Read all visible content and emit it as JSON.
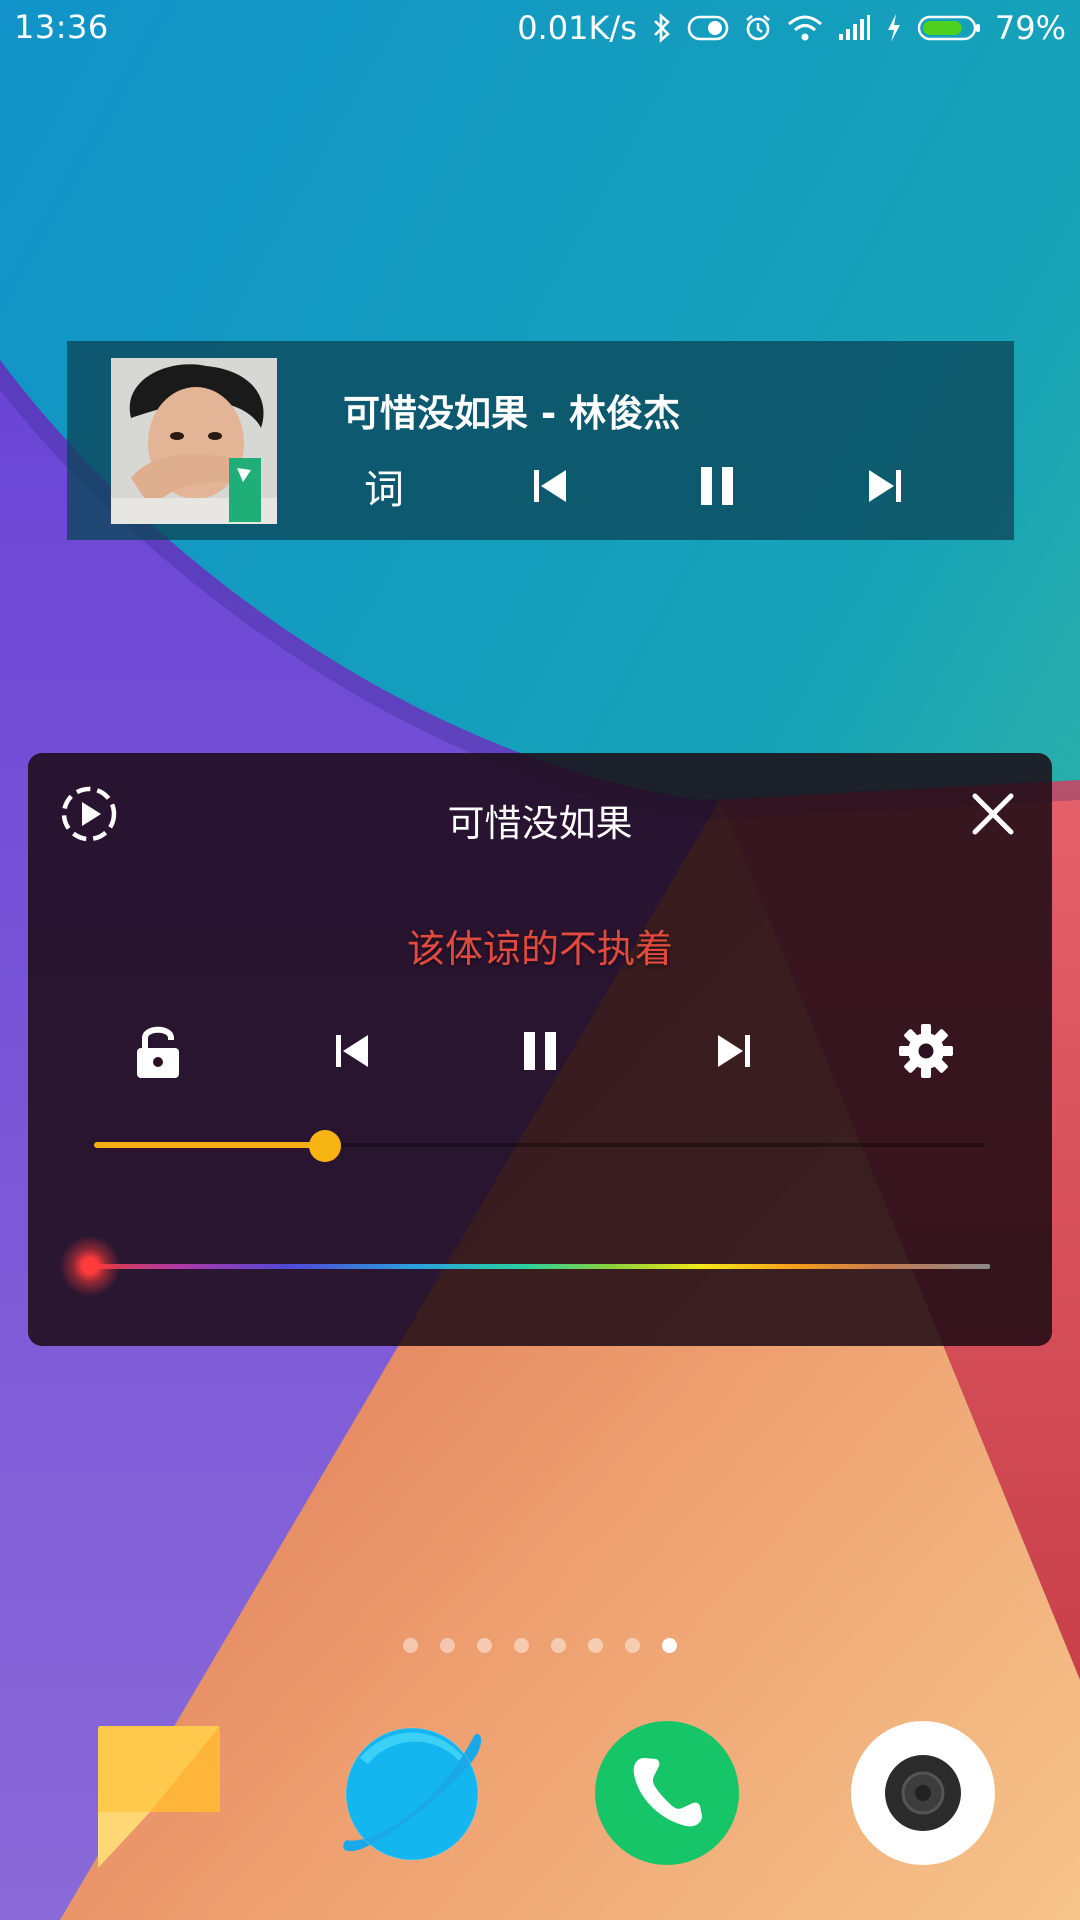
{
  "status_bar": {
    "time": "13:36",
    "network_speed": "0.01K/s",
    "battery_percent": "79%",
    "battery_level": 0.79,
    "icons": [
      "bluetooth-icon",
      "toggle-icon",
      "alarm-icon",
      "wifi-icon",
      "signal-icon",
      "charging-icon",
      "battery-icon"
    ]
  },
  "music_widget": {
    "title": "可惜没如果 - 林俊杰",
    "lyrics_button_label": "词",
    "controls": [
      "previous-icon",
      "pause-icon",
      "next-icon"
    ]
  },
  "lyrics_panel": {
    "title": "可惜没如果",
    "current_lyric_sung": "该体谅的不执着",
    "current_lyric_unsung": "",
    "controls": [
      "lock-icon",
      "previous-icon",
      "pause-icon",
      "next-icon",
      "settings-icon"
    ],
    "font_size_level": 0.26,
    "color_position": 0.0,
    "highlight_color": "#e24a3e",
    "slider_color": "#f5ad13"
  },
  "home_screen": {
    "page_count": 8,
    "active_page": 8,
    "dock_apps": [
      "notes-icon",
      "browser-icon",
      "phone-icon",
      "camera-icon"
    ]
  }
}
